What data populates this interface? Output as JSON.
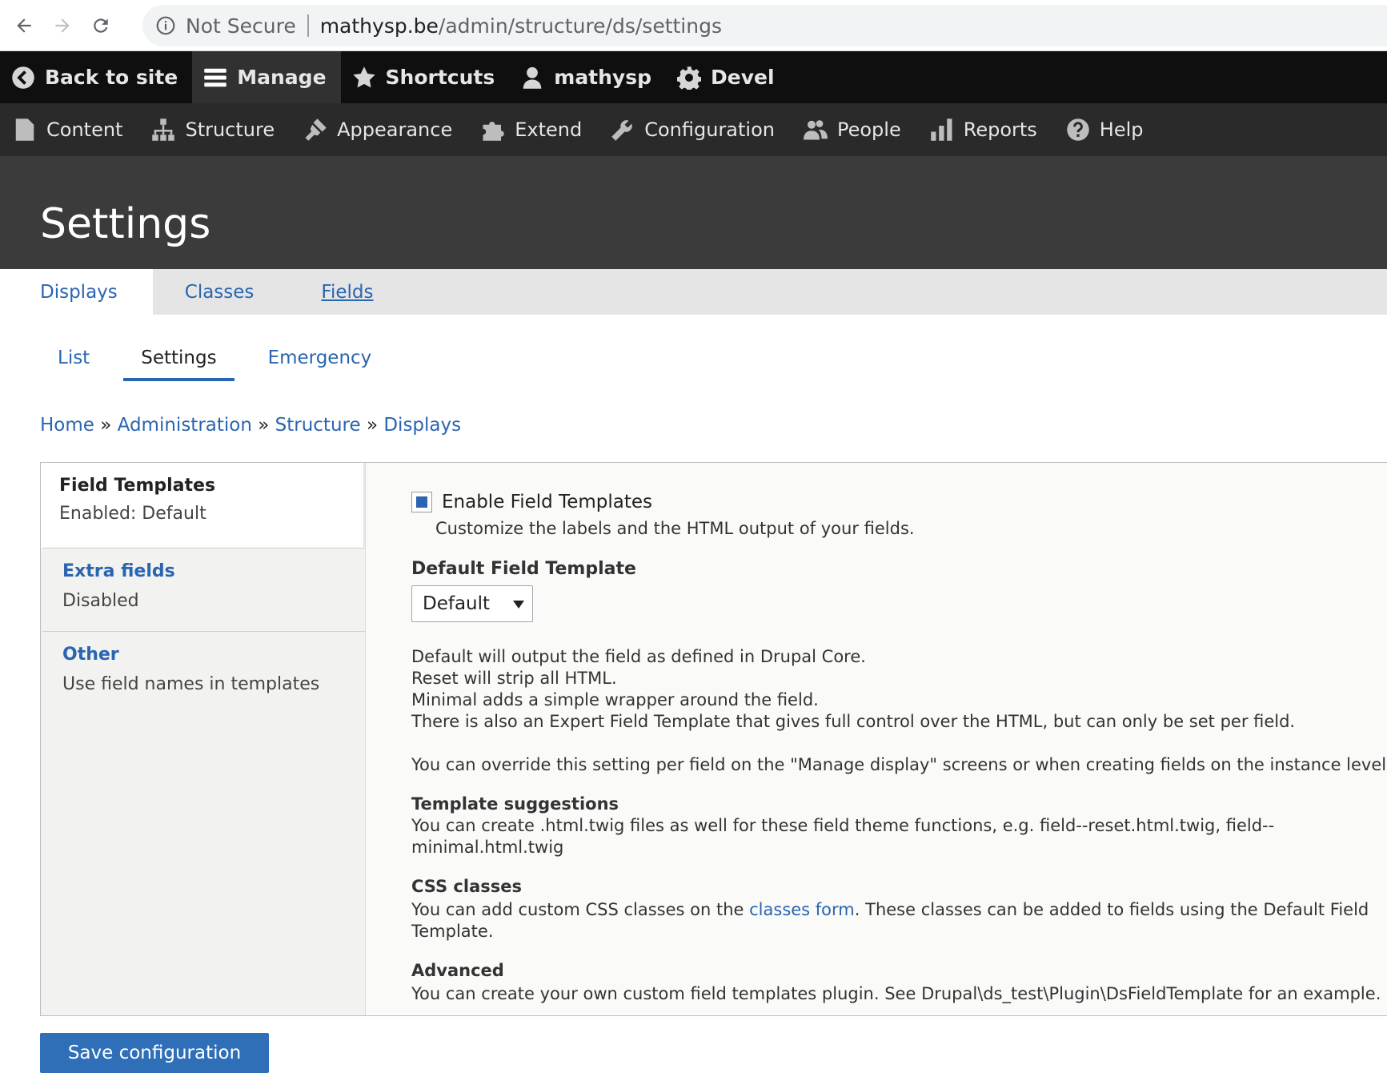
{
  "browser": {
    "security": "Not Secure",
    "url_host": "mathysp.be",
    "url_path": "/admin/structure/ds/settings"
  },
  "toolbar": {
    "items": [
      {
        "label": "Back to site",
        "icon": "back-arrow-icon"
      },
      {
        "label": "Manage",
        "icon": "hamburger-icon"
      },
      {
        "label": "Shortcuts",
        "icon": "star-icon"
      },
      {
        "label": "mathysp",
        "icon": "user-icon"
      },
      {
        "label": "Devel",
        "icon": "gear-icon"
      }
    ]
  },
  "tray": {
    "items": [
      {
        "label": "Content",
        "icon": "file-icon"
      },
      {
        "label": "Structure",
        "icon": "sitemap-icon"
      },
      {
        "label": "Appearance",
        "icon": "brush-icon"
      },
      {
        "label": "Extend",
        "icon": "puzzle-icon"
      },
      {
        "label": "Configuration",
        "icon": "wrench-icon"
      },
      {
        "label": "People",
        "icon": "people-icon"
      },
      {
        "label": "Reports",
        "icon": "bar-chart-icon"
      },
      {
        "label": "Help",
        "icon": "help-icon"
      }
    ]
  },
  "page": {
    "title": "Settings"
  },
  "primary_tabs": [
    {
      "label": "Displays"
    },
    {
      "label": "Classes"
    },
    {
      "label": "Fields"
    }
  ],
  "secondary_tabs": [
    {
      "label": "List"
    },
    {
      "label": "Settings"
    },
    {
      "label": "Emergency"
    }
  ],
  "breadcrumb": {
    "items": [
      "Home",
      "Administration",
      "Structure",
      "Displays"
    ],
    "separator": "»"
  },
  "vertical_tabs": [
    {
      "title": "Field Templates",
      "summary": "Enabled: Default"
    },
    {
      "title": "Extra fields",
      "summary": "Disabled"
    },
    {
      "title": "Other",
      "summary": "Use field names in templates"
    }
  ],
  "field_templates": {
    "enable_label": "Enable Field Templates",
    "enable_checked": true,
    "enable_description": "Customize the labels and the HTML output of your fields.",
    "default_label": "Default Field Template",
    "default_value": "Default",
    "desc_lines": [
      "Default will output the field as defined in Drupal Core.",
      "Reset will strip all HTML.",
      "Minimal adds a simple wrapper around the field.",
      "There is also an Expert Field Template that gives full control over the HTML, but can only be set per field."
    ],
    "override_text": "You can override this setting per field on the \"Manage display\" screens or when creating fields on the instance level.",
    "suggestions_heading": "Template suggestions",
    "suggestions_text": "You can create .html.twig files as well for these field theme functions, e.g. field--reset.html.twig, field--minimal.html.twig",
    "css_heading": "CSS classes",
    "css_text_before": "You can add custom CSS classes on the ",
    "css_link": "classes form",
    "css_text_after": ". These classes can be added to fields using the Default Field Template.",
    "advanced_heading": "Advanced",
    "advanced_text": "You can create your own custom field templates plugin. See Drupal\\ds_test\\Plugin\\DsFieldTemplate for an example."
  },
  "actions": {
    "save_label": "Save configuration"
  },
  "colors": {
    "link": "#2a65b0",
    "toolbar_bg": "#0f0f0f",
    "tray_bg": "#2a2a2a",
    "header_bg": "#3b3b3b",
    "button_bg": "#2f6fb8"
  }
}
